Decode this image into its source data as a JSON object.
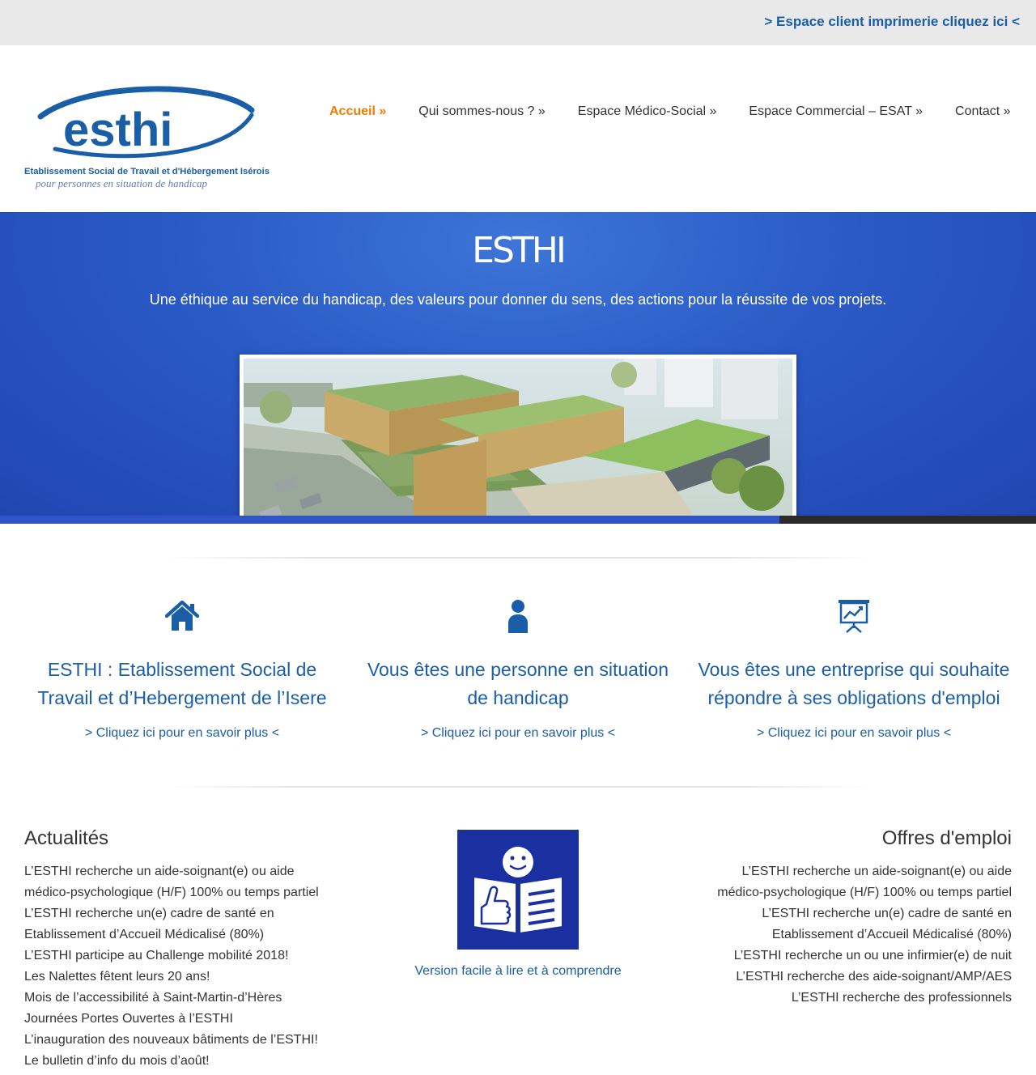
{
  "topbar": {
    "client_link": "> Espace client imprimerie cliquez ici <"
  },
  "logo": {
    "brand": "esthi",
    "line1": "Etablissement Social de Travail et d'Hébergement Isérois",
    "line2": "pour personnes en situation de handicap"
  },
  "nav": [
    {
      "label": "Accueil »",
      "active": true
    },
    {
      "label": "Qui sommes-nous ? »"
    },
    {
      "label": "Espace Médico-Social »"
    },
    {
      "label": "Espace Commercial – ESAT »"
    },
    {
      "label": "Contact »"
    }
  ],
  "hero": {
    "title": "ESTHI",
    "subtitle": "Une éthique au service du handicap, des valeurs pour donner du sens, des actions pour la réussite de vos projets.",
    "progress": 0.752
  },
  "features": [
    {
      "icon": "home-icon",
      "title": "ESTHI : Etablissement Social de Travail et d’Hebergement de l’Isere",
      "link": "> Cliquez ici pour en savoir plus <"
    },
    {
      "icon": "person-icon",
      "title": "Vous êtes une personne en situation de handicap",
      "link": "> Cliquez ici pour en savoir plus <"
    },
    {
      "icon": "presentation-chart-icon",
      "title": "Vous êtes une entreprise qui souhaite répondre à ses obligations d'emploi",
      "link": "> Cliquez ici pour en savoir plus <"
    }
  ],
  "news": {
    "title": "Actualités",
    "items": [
      "L’ESTHI recherche un aide-soignant(e) ou aide médico-psychologique (H/F) 100% ou temps partiel",
      "L’ESTHI recherche un(e) cadre de santé en Etablissement d’Accueil Médicalisé (80%)",
      "L’ESTHI participe au Challenge mobilité 2018!",
      "Les Nalettes fêtent leurs 20 ans!",
      "Mois de l’accessibilité à Saint-Martin-d’Hères",
      "Journées Portes Ouvertes à l’ESTHI",
      "L’inauguration des nouveaux bâtiments de l’ESTHI!",
      "Le bulletin d’info du mois d’août!"
    ]
  },
  "easy_read": {
    "link": "Version facile à lire et à comprendre"
  },
  "jobs": {
    "title": "Offres d'emploi",
    "items": [
      "L’ESTHI recherche un aide-soignant(e) ou aide médico-psychologique (H/F) 100% ou temps partiel",
      "L’ESTHI recherche un(e) cadre de santé en Etablissement d’Accueil Médicalisé (80%)",
      "L’ESTHI recherche un ou une infirmier(e) de nuit",
      "L’ESTHI recherche des aide-soignant/AMP/AES",
      "L’ESTHI recherche des professionnels"
    ]
  },
  "colors": {
    "accent": "#1a5ea8",
    "active_nav": "#f07d00",
    "hero": "#2a5ac6",
    "easy_read_bg": "#1a2fa0"
  }
}
